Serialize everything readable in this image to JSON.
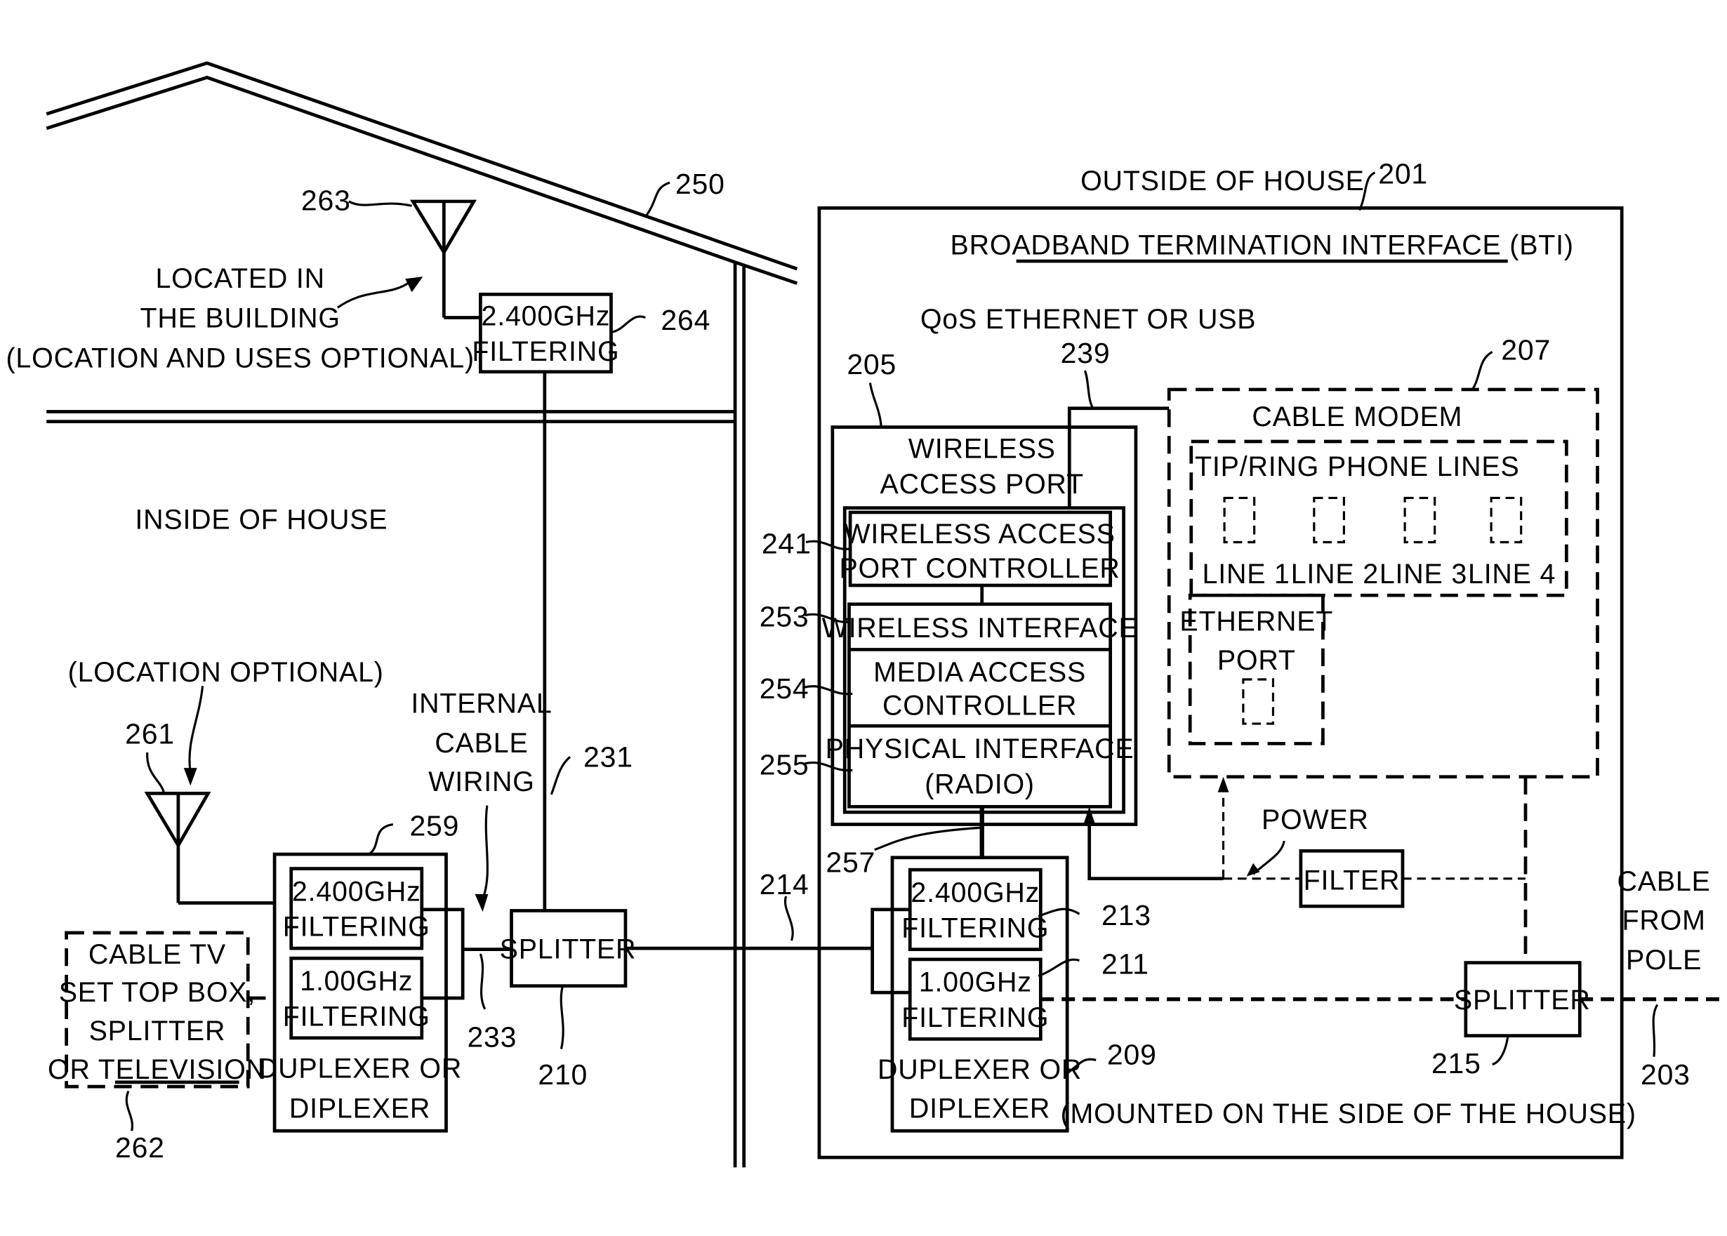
{
  "figure": {
    "colors": {
      "line": "#000000",
      "background": "#ffffff"
    },
    "regions": {
      "outside": "OUTSIDE OF HOUSE",
      "inside": "INSIDE OF HOUSE"
    },
    "refs": {
      "house": "250",
      "bti": "201",
      "wap": "205",
      "qos_link": "239",
      "cable_modem": "207",
      "wap_controller": "241",
      "wireless_interface": "253",
      "mac": "254",
      "phy": "255",
      "wap_link": "257",
      "cable_214": "214",
      "filter_213": "213",
      "filter_211": "211",
      "duplexer_209": "209",
      "splitter_215": "215",
      "cable_203": "203",
      "antenna_263": "263",
      "filter_264": "264",
      "antenna_261": "261",
      "set_top_262": "262",
      "duplexer_259": "259",
      "wiring_231": "231",
      "wiring_233": "233",
      "splitter_210": "210"
    },
    "bti": {
      "title": "BROADBAND TERMINATION INTERFACE (BTI)",
      "qos_label": "QoS ETHERNET OR USB",
      "mount_note": "(MOUNTED ON THE SIDE OF THE HOUSE)"
    },
    "wap": {
      "title_line1": "WIRELESS",
      "title_line2": "ACCESS PORT",
      "controller_line1": "WIRELESS ACCESS",
      "controller_line2": "PORT CONTROLLER",
      "wireless_interface": "WIRELESS INTERFACE",
      "mac_line1": "MEDIA ACCESS",
      "mac_line2": "CONTROLLER",
      "phy_line1": "PHYSICAL INTERFACE",
      "phy_line2": "(RADIO)"
    },
    "cable_modem": {
      "title": "CABLE MODEM",
      "phone_group": "TIP/RING PHONE LINES",
      "lines": [
        "LINE 1",
        "LINE 2",
        "LINE 3",
        "LINE 4"
      ],
      "ethernet_line1": "ETHERNET",
      "ethernet_line2": "PORT"
    },
    "power": {
      "label": "POWER",
      "filter": "FILTER"
    },
    "outside_duplexer": {
      "f24_line1": "2.400GHz",
      "f24_line2": "FILTERING",
      "f1_line1": "1.00GHz",
      "f1_line2": "FILTERING",
      "label_line1": "DUPLEXER OR",
      "label_line2": "DIPLEXER"
    },
    "splitter_outside": "SPLITTER",
    "cable_from_pole": [
      "CABLE",
      "FROM",
      "POLE"
    ],
    "attic": {
      "note_line1": "LOCATED IN",
      "note_line2": "THE BUILDING",
      "note_line3": "(LOCATION AND USES OPTIONAL)",
      "filter_line1": "2.400GHz",
      "filter_line2": "FILTERING"
    },
    "inside": {
      "location_note": "(LOCATION OPTIONAL)",
      "wiring_line1": "INTERNAL",
      "wiring_line2": "CABLE",
      "wiring_line3": "WIRING",
      "splitter": "SPLITTER",
      "settop_line1": "CABLE TV",
      "settop_line2": "SET TOP BOX,",
      "settop_line3": "SPLITTER",
      "settop_line4": "OR TELEVISION",
      "f24_line1": "2.400GHz",
      "f24_line2": "FILTERING",
      "f1_line1": "1.00GHz",
      "f1_line2": "FILTERING",
      "dup_line1": "DUPLEXER OR",
      "dup_line2": "DIPLEXER"
    }
  }
}
